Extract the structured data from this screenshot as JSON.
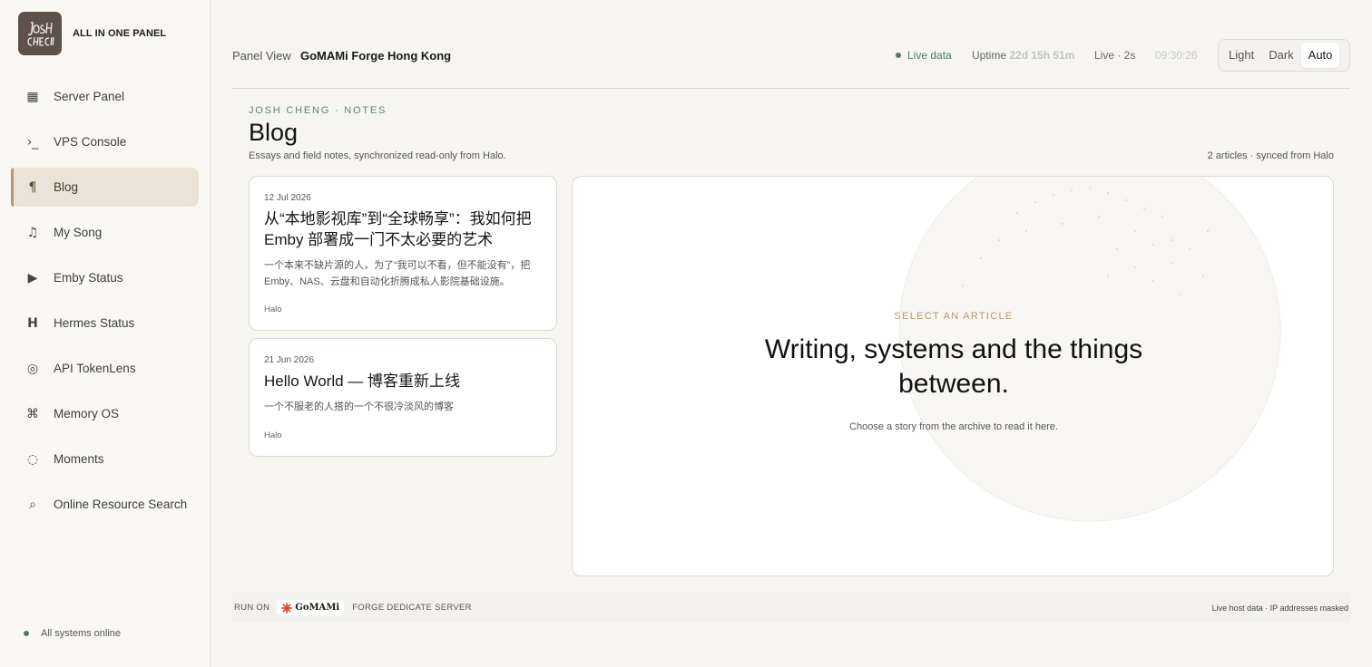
{
  "brand": {
    "logo_text": "JOSH CHENG",
    "name": "ALL IN ONE PANEL"
  },
  "sidebar": {
    "items": [
      {
        "label": "Server Panel",
        "icon": "grid-icon",
        "glyph": "▦",
        "active": false
      },
      {
        "label": "VPS Console",
        "icon": "terminal-icon",
        "glyph": "›_",
        "active": false
      },
      {
        "label": "Blog",
        "icon": "pilcrow-icon",
        "glyph": "¶",
        "active": true
      },
      {
        "label": "My Song",
        "icon": "music-note-icon",
        "glyph": "♫",
        "active": false
      },
      {
        "label": "Emby Status",
        "icon": "play-icon",
        "glyph": "▶",
        "active": false
      },
      {
        "label": "Hermes Status",
        "icon": "letter-h-icon",
        "glyph": "H",
        "active": false
      },
      {
        "label": "API TokenLens",
        "icon": "target-icon",
        "glyph": "◎",
        "active": false
      },
      {
        "label": "Memory OS",
        "icon": "command-icon",
        "glyph": "⌘",
        "active": false
      },
      {
        "label": "Moments",
        "icon": "dotted-circle-icon",
        "glyph": "◌",
        "active": false
      },
      {
        "label": "Online Resource Search",
        "icon": "search-icon",
        "glyph": "⌕",
        "active": false
      }
    ],
    "status": "All systems online"
  },
  "topbar": {
    "crumb": "Panel View",
    "title": "GoMAMi Forge Hong Kong",
    "live": "Live data",
    "uptime_label": "Uptime",
    "uptime_value": "22d 15h 51m",
    "refresh": "Live · 2s",
    "clock": "09:30:26",
    "themes": [
      "Light",
      "Dark",
      "Auto"
    ],
    "theme_selected": "Auto"
  },
  "page": {
    "eyebrow": "JOSH CHENG · NOTES",
    "title": "Blog",
    "subtitle": "Essays and field notes, synchronized read-only from Halo.",
    "count": "2 articles · synced from Halo"
  },
  "articles": [
    {
      "date": "12 Jul 2026",
      "title": "从“本地影视库”到“全球畅享”：我如何把 Emby 部署成一门不太必要的艺术",
      "excerpt": "一个本来不缺片源的人，为了“我可以不看，但不能没有”，把 Emby、NAS、云盘和自动化折腾成私人影院基础设施。",
      "source": "Halo"
    },
    {
      "date": "21 Jun 2026",
      "title": "Hello World — 博客重新上线",
      "excerpt": "一个不服老的人搭的一个不很冷淡风的博客",
      "source": "Halo"
    }
  ],
  "reader": {
    "eyebrow": "SELECT AN ARTICLE",
    "title": "Writing, systems and the things between.",
    "subtitle": "Choose a story from the archive to read it here."
  },
  "footer": {
    "run_on": "RUN ON",
    "badge": "GoMAMi",
    "forge": "FORGE DEDICATE SERVER",
    "note": "Live host data · IP addresses masked"
  },
  "colors": {
    "accent": "#4f7b63",
    "active_bg": "#ebe3d7",
    "gold": "#b59a6f",
    "gomami": "#e04a2a"
  }
}
